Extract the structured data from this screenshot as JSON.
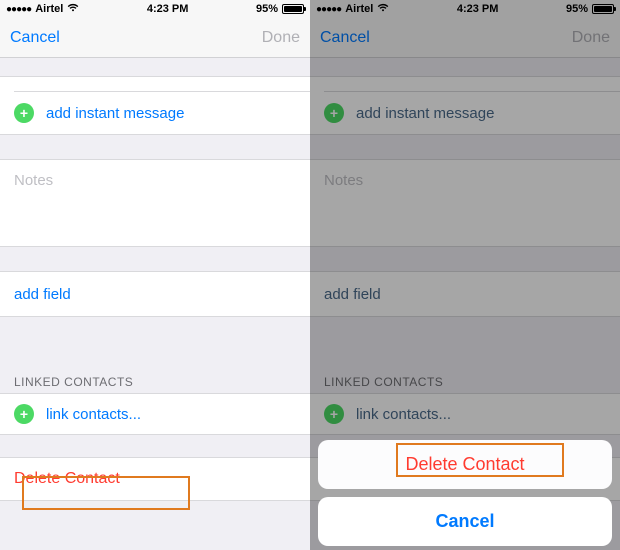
{
  "statusbar": {
    "carrier": "Airtel",
    "time": "4:23 PM",
    "battery_pct": "95%"
  },
  "nav": {
    "cancel": "Cancel",
    "done": "Done"
  },
  "rows": {
    "add_im": "add instant message",
    "notes": "Notes",
    "add_field": "add field",
    "linked_header": "LINKED CONTACTS",
    "link_contacts": "link contacts...",
    "delete_contact": "Delete Contact"
  },
  "sheet": {
    "delete": "Delete Contact",
    "cancel": "Cancel"
  }
}
